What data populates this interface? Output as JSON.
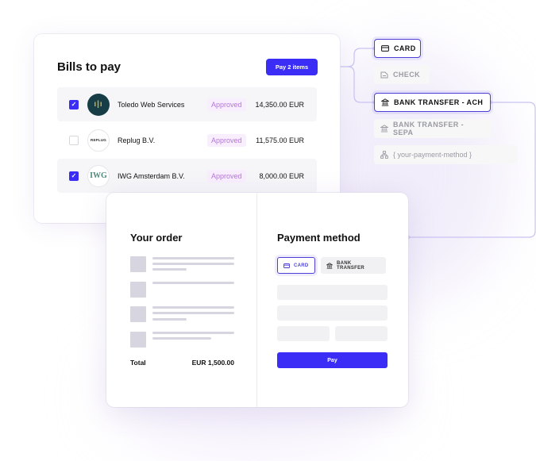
{
  "bills": {
    "title": "Bills to pay",
    "pay_button_label": "Pay 2 items",
    "rows": [
      {
        "checked": true,
        "logo_text": "ı|ı",
        "vendor": "Toledo Web Services",
        "status": "Approved",
        "amount": "14,350.00 EUR"
      },
      {
        "checked": false,
        "logo_text": "REPLUG",
        "vendor": "Replug B.V.",
        "status": "Approved",
        "amount": "11,575.00 EUR"
      },
      {
        "checked": true,
        "logo_text": "IWG",
        "vendor": "IWG Amsterdam B.V.",
        "status": "Approved",
        "amount": "8,000.00 EUR"
      }
    ],
    "check_glyph": "✓"
  },
  "payment_options": [
    {
      "label": "CARD",
      "icon": "card-icon",
      "state": "active"
    },
    {
      "label": "CHECK",
      "icon": "check-document-icon",
      "state": "inactive"
    },
    {
      "label": "BANK TRANSFER - ACH",
      "icon": "bank-icon",
      "state": "active"
    },
    {
      "label": "BANK TRANSFER - SEPA",
      "icon": "bank-icon",
      "state": "inactive"
    },
    {
      "label": "{ your-payment-method }",
      "icon": "hierarchy-icon",
      "state": "inactive"
    }
  ],
  "order": {
    "title": "Your order",
    "total_label": "Total",
    "total_value": "EUR 1,500.00"
  },
  "payment_method": {
    "title": "Payment method",
    "tabs": [
      {
        "label": "CARD",
        "icon": "card-icon",
        "selected": true
      },
      {
        "label": "BANK TRANSFER",
        "icon": "bank-icon",
        "selected": false
      }
    ],
    "pay_button_label": "Pay"
  },
  "colors": {
    "accent": "#3b2df5",
    "approved_badge_bg": "#f8eefd",
    "approved_badge_text": "#b577d9",
    "connector": "#c9c3f3"
  }
}
